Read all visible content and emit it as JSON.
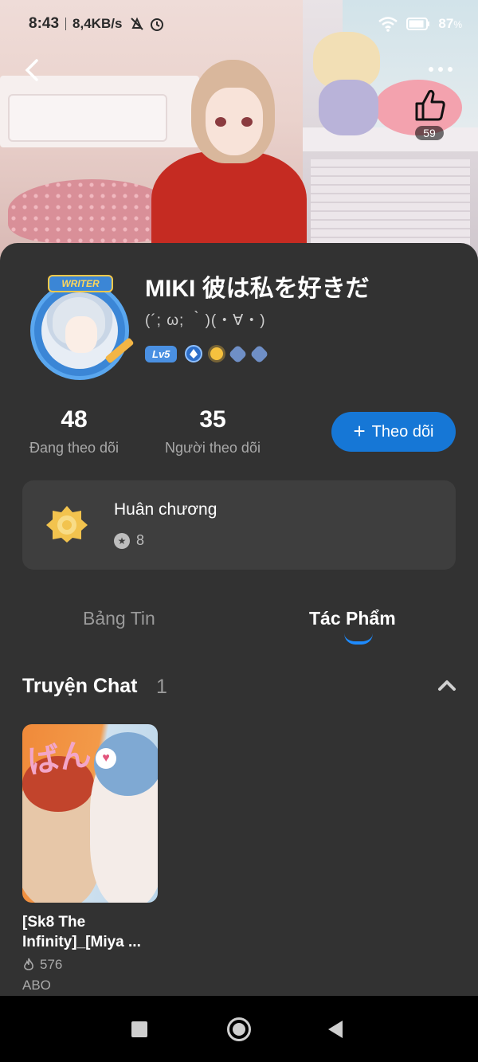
{
  "status_bar": {
    "time": "8:43",
    "network_speed": "8,4KB/s",
    "battery": "87",
    "battery_unit": "%"
  },
  "header": {
    "like_count": "59"
  },
  "profile": {
    "badge_label": "WRITER",
    "username": "MIKI 彼は私を好きだ",
    "bio": "(´; ω; ｀)(・∀・)",
    "level": "Lv5"
  },
  "stats": {
    "following_count": "48",
    "following_label": "Đang theo dõi",
    "followers_count": "35",
    "followers_label": "Người theo dõi"
  },
  "follow_button": {
    "icon": "+",
    "label": "Theo dõi"
  },
  "medals": {
    "title": "Huân chương",
    "count": "8"
  },
  "tabs": [
    {
      "label": "Bảng Tin",
      "active": false
    },
    {
      "label": "Tác Phẩm",
      "active": true
    }
  ],
  "section": {
    "title": "Truyện Chat",
    "count": "1"
  },
  "works": [
    {
      "title_line1": "[Sk8 The",
      "title_line2": "Infinity]_[Miya ...",
      "views": "576",
      "tag": "ABO"
    }
  ],
  "colors": {
    "panel_bg": "#323232",
    "card_bg": "#3e3e3e",
    "accent": "#1677d6",
    "tab_indicator": "#1e8bff",
    "level_badge": "#4a90e2"
  }
}
